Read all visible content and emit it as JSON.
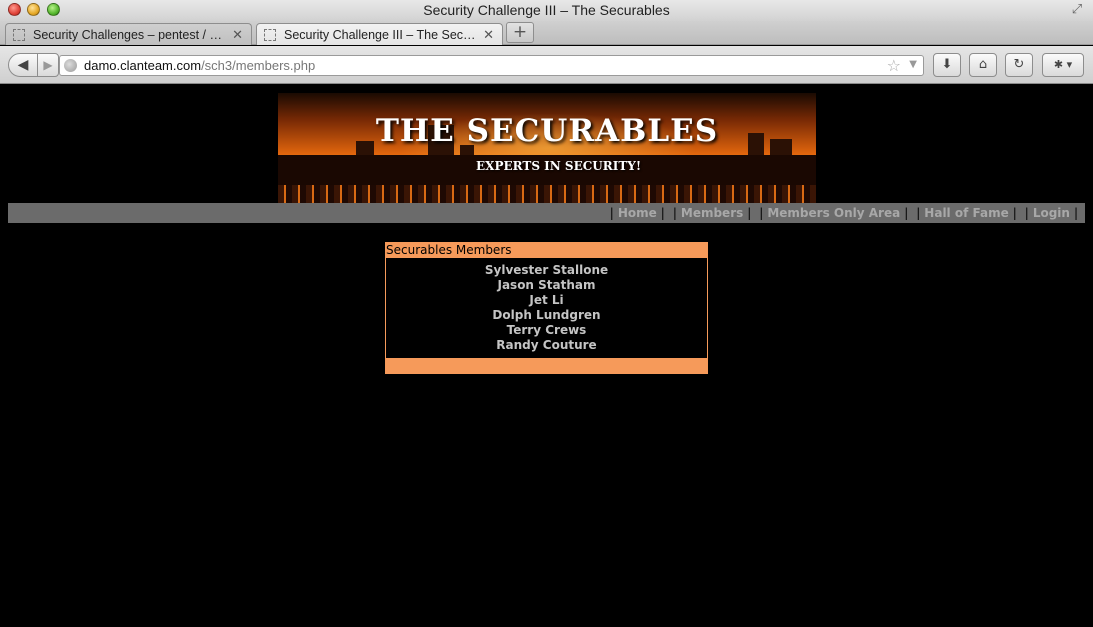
{
  "window": {
    "title": "Security Challenge III – The Securables"
  },
  "tabs": [
    {
      "label": "Security Challenges – pentest / …",
      "active": false
    },
    {
      "label": "Security Challenge III – The Securables",
      "active": true
    }
  ],
  "toolbar": {
    "url_domain": "damo.clanteam.com",
    "url_path": "/sch3/members.php"
  },
  "banner": {
    "title": "THE SECURABLES",
    "subtitle": "EXPERTS IN SECURITY!"
  },
  "menu": [
    {
      "label": "Home"
    },
    {
      "label": "Members"
    },
    {
      "label": "Members Only Area"
    },
    {
      "label": "Hall of Fame"
    },
    {
      "label": "Login"
    }
  ],
  "members_panel": {
    "header": "Securables Members",
    "names": [
      "Sylvester Stallone",
      "Jason Statham",
      "Jet Li",
      "Dolph Lundgren",
      "Terry Crews",
      "Randy Couture"
    ]
  },
  "colors": {
    "page_background": "#000000",
    "menu_bar": "#6b6b6b",
    "menu_link": "#a8a8a8",
    "panel_accent": "#f69a5a",
    "member_text": "#c4c4c4"
  }
}
